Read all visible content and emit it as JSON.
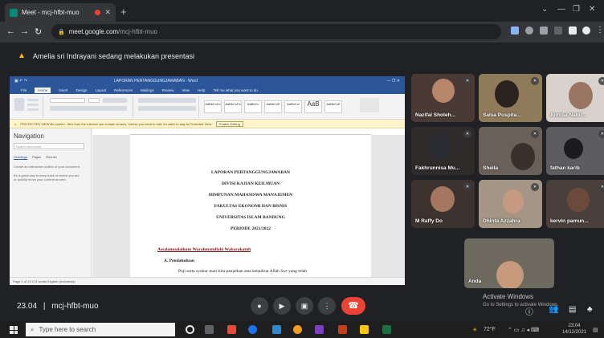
{
  "browser": {
    "tab_title": "Meet - mcj-hfbt-muo",
    "close_glyph": "✕",
    "new_tab_glyph": "+",
    "url_domain": "meet.google.com",
    "url_path": "/mcj-hfbt-muo"
  },
  "banner": {
    "text": "Amelia sri Indrayani sedang melakukan presentasi",
    "icon": "presenting-icon"
  },
  "word": {
    "title": "LAPORAN PERTANGGUNGJAWABAN - Word",
    "tabs": [
      "File",
      "Home",
      "Insert",
      "Design",
      "Layout",
      "References",
      "Mailings",
      "Review",
      "View",
      "Help",
      "Tell me what you want to do"
    ],
    "protected_view": "PROTECTED VIEW  Be careful - files from the Internet can contain viruses. Unless you need to edit, it's safer to stay in Protected View.",
    "enable_label": "Enable Editing",
    "nav_title": "Navigation",
    "nav_search": "Search document",
    "nav_tabs": [
      "Headings",
      "Pages",
      "Results"
    ],
    "nav_help1": "Create an interactive outline of your document.",
    "nav_help2": "It's a great way to keep track of where you are or quickly move your content around.",
    "status": "Page 1 of 13   174 words   English (Indonesia)",
    "doc_lines": [
      "LAPORAN PERTANGGUNGJAWABAN",
      "DIVISI KAJIAN KEILMUAN",
      "HIMPUNAN MAHASISWA MANAJEMEN",
      "FAKULTAS EKONOMI DAN BISNIS",
      "UNIVERSITAS ISLAM BANDUNG",
      "PERIODE 2021/2022"
    ],
    "section_heading": "Assalamualaikum Warahmatullahi Wabarakatuh",
    "subheading": "A.  Pendahuluan",
    "paragraph": "Puji serta syukur mari kita panjatkan atas kehadirat Allah Swt yang telah"
  },
  "participants": [
    {
      "name": "Nazifal Sholeh..."
    },
    {
      "name": "Salsa Puspita..."
    },
    {
      "name": "Annisa Nabil..."
    },
    {
      "name": "Fakhrunnisa Mu..."
    },
    {
      "name": "Sheila"
    },
    {
      "name": "fathan karib"
    },
    {
      "name": "M Raffy Do"
    },
    {
      "name": "Dhinta Azzahra"
    },
    {
      "name": "kervin pamun..."
    },
    {
      "name": "Anda"
    }
  ],
  "meeting": {
    "time": "23.04",
    "separator": "|",
    "code": "mcj-hfbt-muo"
  },
  "watermark": {
    "line1": "Activate Windows",
    "line2": "Go to Settings to activate Windows."
  },
  "taskbar": {
    "search_placeholder": "Type here to search",
    "weather": "72°F",
    "clock_time": "23:04",
    "clock_date": "14/12/2021"
  }
}
